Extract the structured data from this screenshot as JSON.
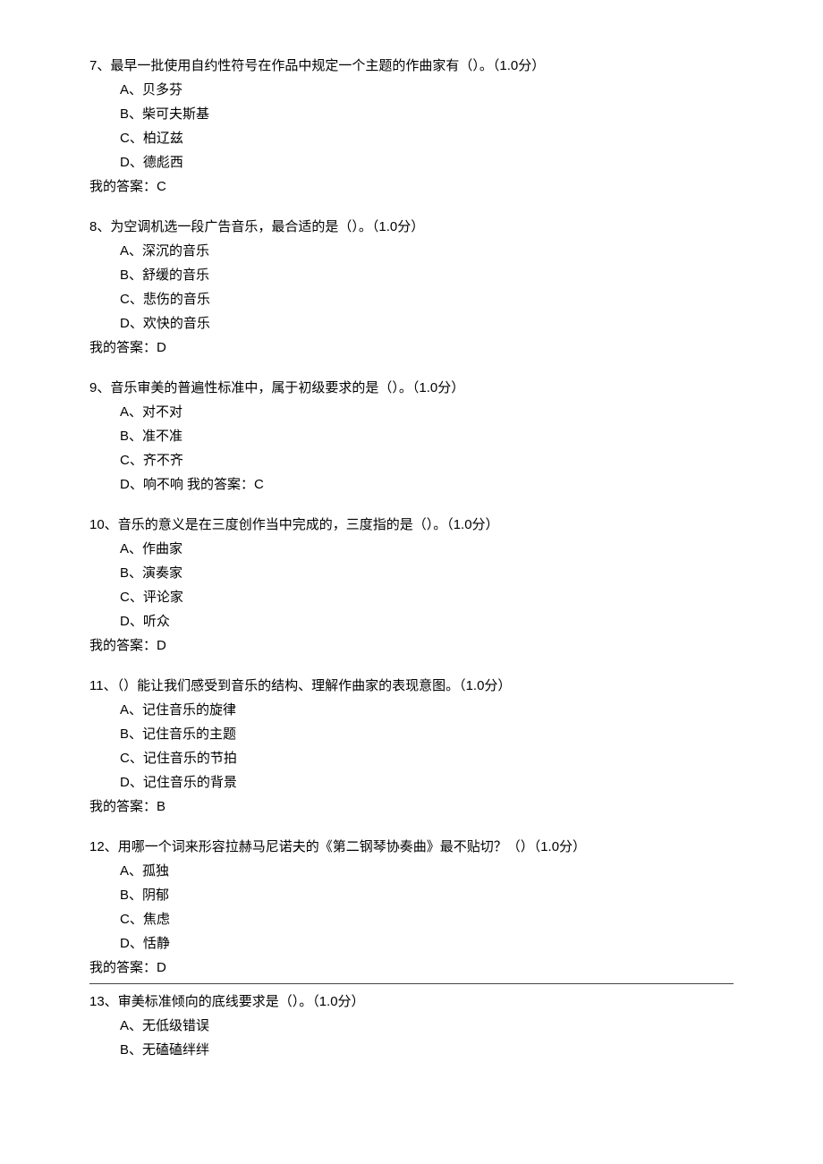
{
  "questions": [
    {
      "num": "7、",
      "text": "最早一批使用自约性符号在作品中规定一个主题的作曲家有（）。（1.0分）",
      "options": {
        "A": "A、贝多芬",
        "B": "B、柴可夫斯基",
        "C": "C、柏辽兹",
        "D": "D、德彪西"
      },
      "answer": "我的答案：C"
    },
    {
      "num": "8、",
      "text": "为空调机选一段广告音乐，最合适的是（）。（1.0分）",
      "options": {
        "A": "A、深沉的音乐",
        "B": "B、舒缓的音乐",
        "C": "C、悲伤的音乐",
        "D": "D、欢快的音乐"
      },
      "answer": "我的答案：D"
    },
    {
      "num": "9、",
      "text": "音乐审美的普遍性标准中，属于初级要求的是（）。（1.0分）",
      "options": {
        "A": "A、对不对",
        "B": "B、准不准",
        "C": "C、齐不齐",
        "D": "D、响不响  我的答案：C"
      },
      "answer": ""
    },
    {
      "num": "10、",
      "text": "音乐的意义是在三度创作当中完成的，三度指的是（）。（1.0分）",
      "options": {
        "A": "A、作曲家",
        "B": "B、演奏家",
        "C": "C、评论家",
        "D": "D、听众"
      },
      "answer": "我的答案：D"
    },
    {
      "num": "11、",
      "text": "（）能让我们感受到音乐的结构、理解作曲家的表现意图。（1.0分）",
      "options": {
        "A": "A、记住音乐的旋律",
        "B": "B、记住音乐的主题",
        "C": "C、记住音乐的节拍",
        "D": "D、记住音乐的背景"
      },
      "answer": "我的答案：B"
    },
    {
      "num": "12、",
      "text": "用哪一个词来形容拉赫马尼诺夫的《第二钢琴协奏曲》最不贴切？（）（1.0分）",
      "options": {
        "A": "A、孤独",
        "B": "B、阴郁",
        "C": "C、焦虑",
        "D": "D、恬静"
      },
      "answer": "我的答案：D"
    },
    {
      "num": "13、",
      "text": "审美标准倾向的底线要求是（）。（1.0分）",
      "options": {
        "A": "A、无低级错误",
        "B": "B、无磕磕绊绊"
      },
      "answer": ""
    }
  ]
}
